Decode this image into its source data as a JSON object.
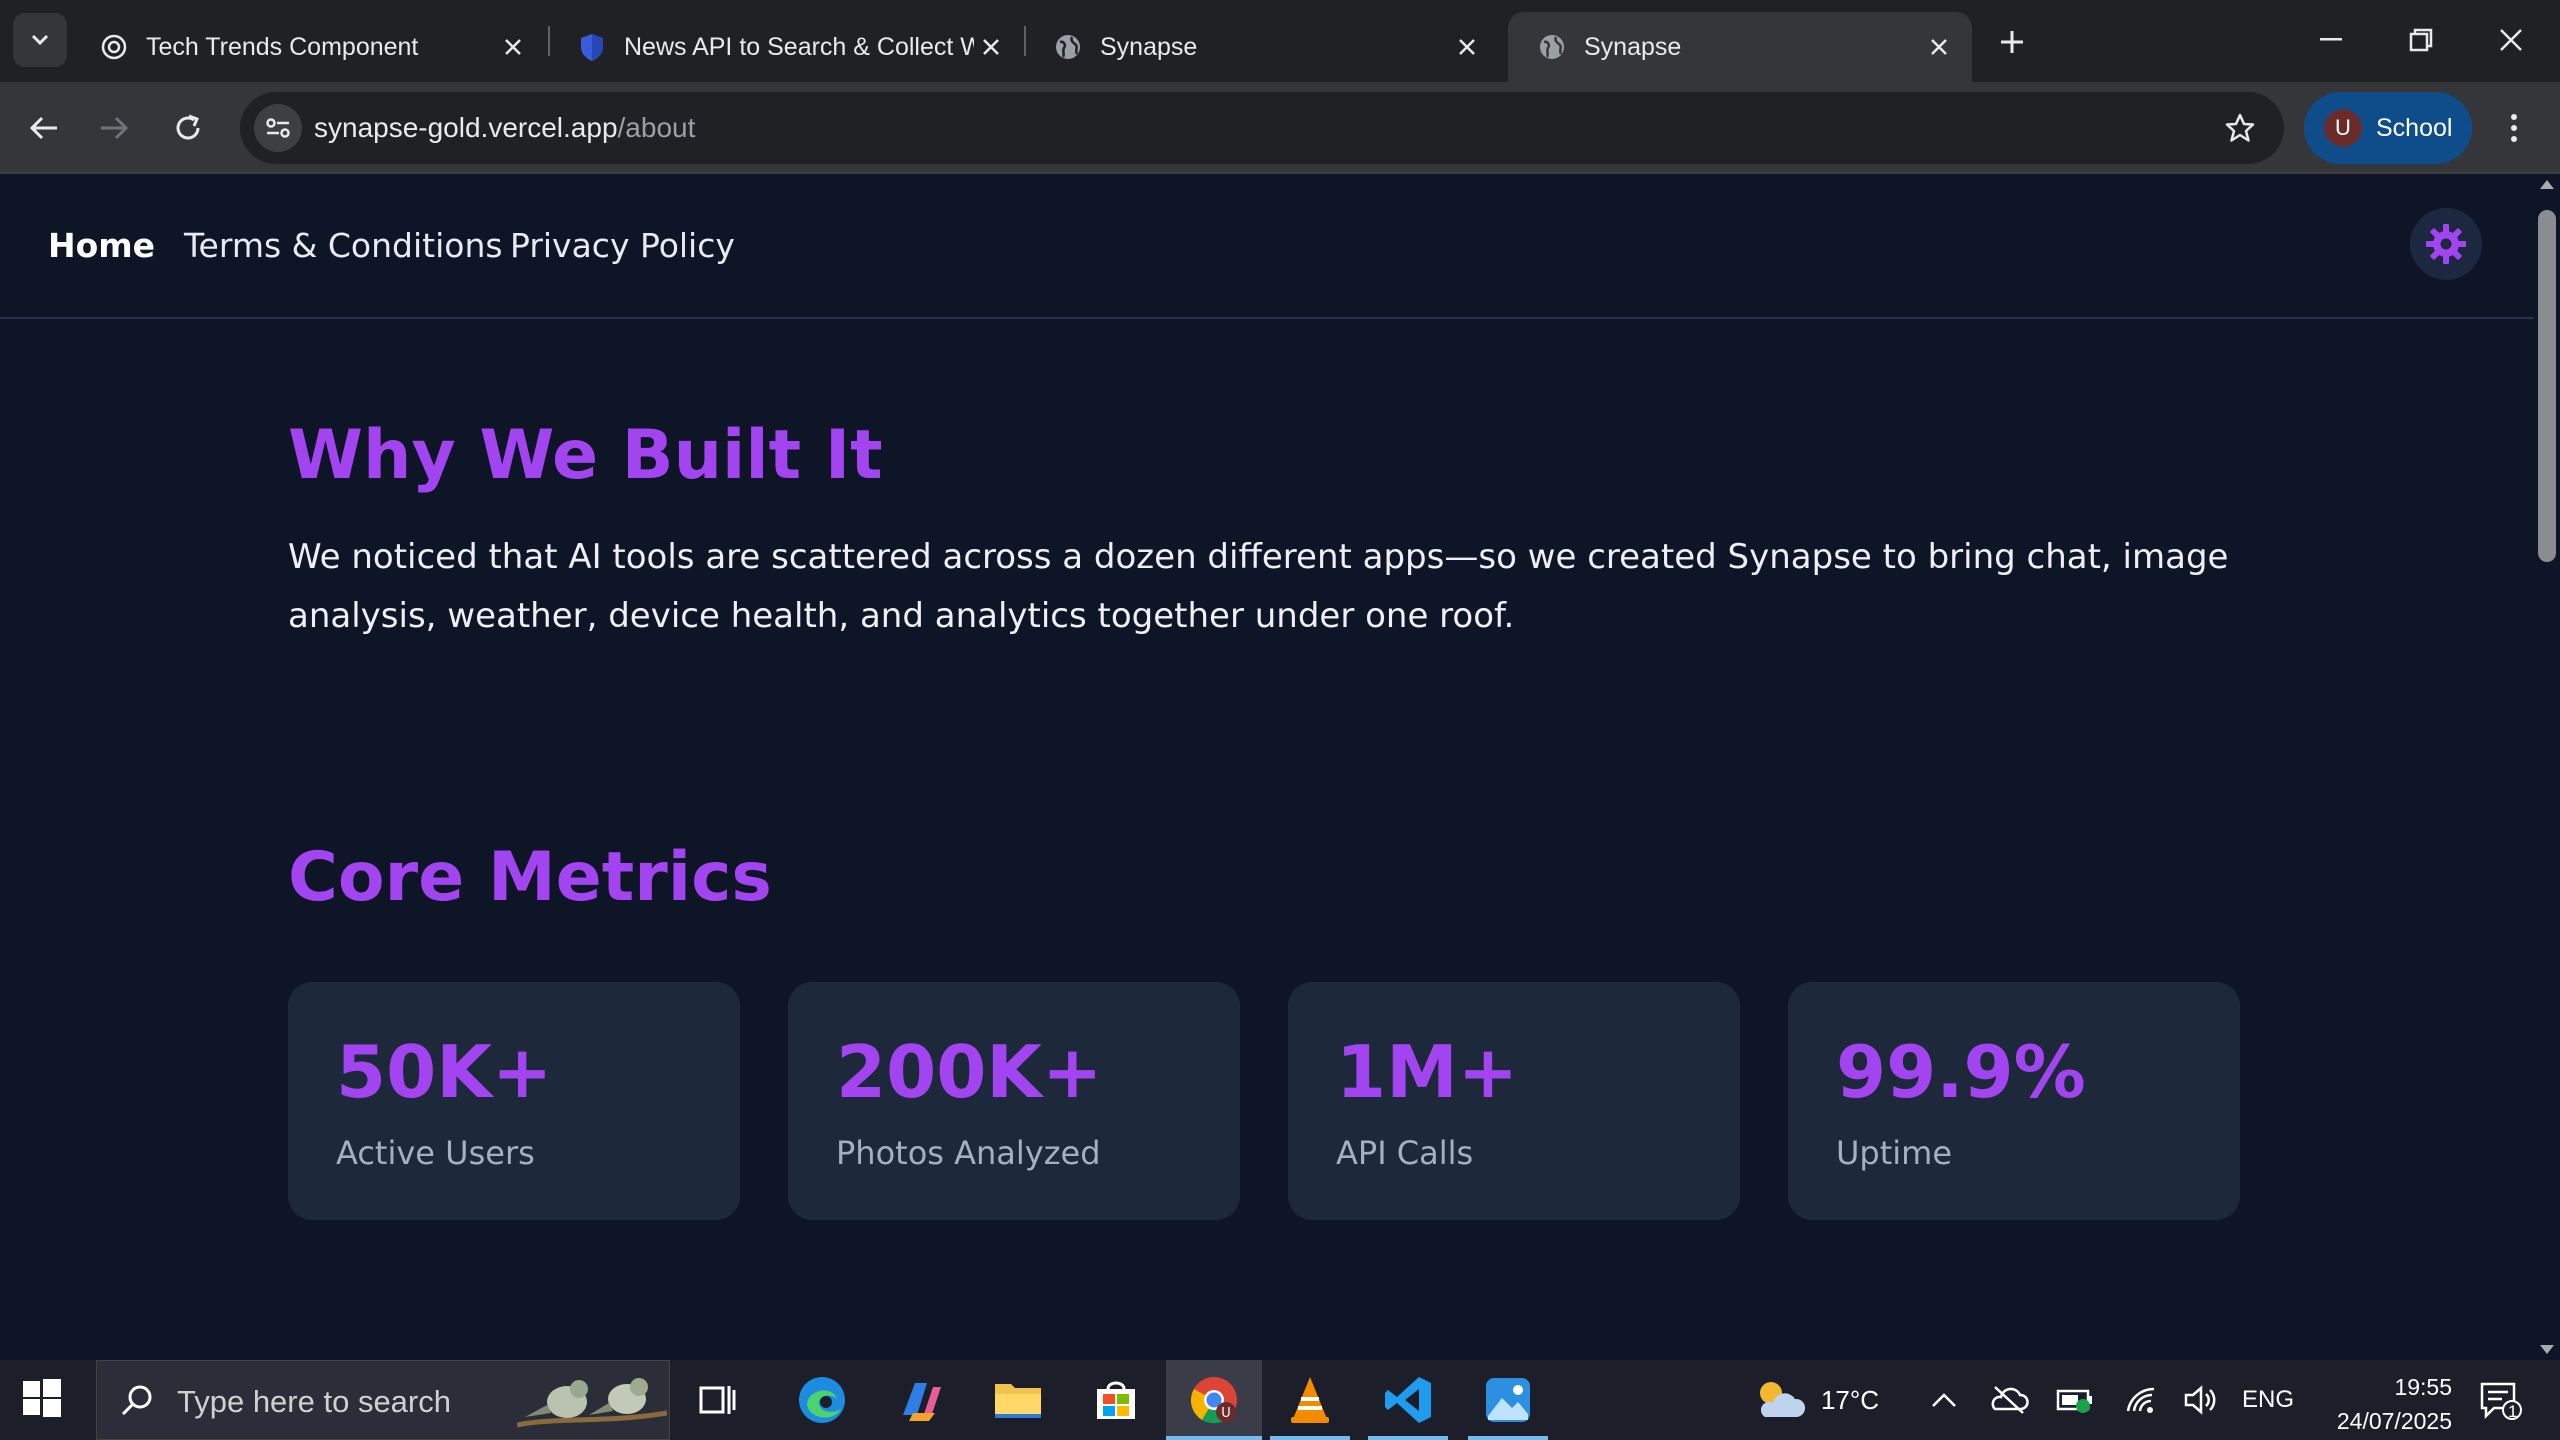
{
  "browser": {
    "tabs": [
      {
        "title": "Tech Trends Component",
        "icon": "openai-icon",
        "active": false
      },
      {
        "title": "News API to Search & Collect W",
        "icon": "shield-icon",
        "active": false
      },
      {
        "title": "Synapse",
        "icon": "globe-icon",
        "active": false
      },
      {
        "title": "Synapse",
        "icon": "globe-icon",
        "active": true
      }
    ],
    "url_domain": "synapse-gold.vercel.app",
    "url_path": "/about",
    "profile_initial": "U",
    "profile_name": "School"
  },
  "page": {
    "nav": {
      "home": "Home",
      "terms": "Terms & Conditions",
      "privacy": "Privacy Policy"
    },
    "why": {
      "heading": "Why We Built It",
      "body": "We noticed that AI tools are scattered across a dozen different apps—so we created Synapse to bring chat, image analysis, weather, device health, and analytics together under one roof."
    },
    "metrics": {
      "heading": "Core Metrics",
      "items": [
        {
          "value": "50K+",
          "label": "Active Users"
        },
        {
          "value": "200K+",
          "label": "Photos Analyzed"
        },
        {
          "value": "1M+",
          "label": "API Calls"
        },
        {
          "value": "99.9%",
          "label": "Uptime"
        }
      ]
    },
    "accent_color": "#a244f0",
    "background_color": "#0e1526",
    "card_color": "#1d293b"
  },
  "taskbar": {
    "search_placeholder": "Type here to search",
    "weather": "17°C",
    "language": "ENG",
    "time": "19:55",
    "date": "24/07/2025",
    "notification_count": "1"
  }
}
